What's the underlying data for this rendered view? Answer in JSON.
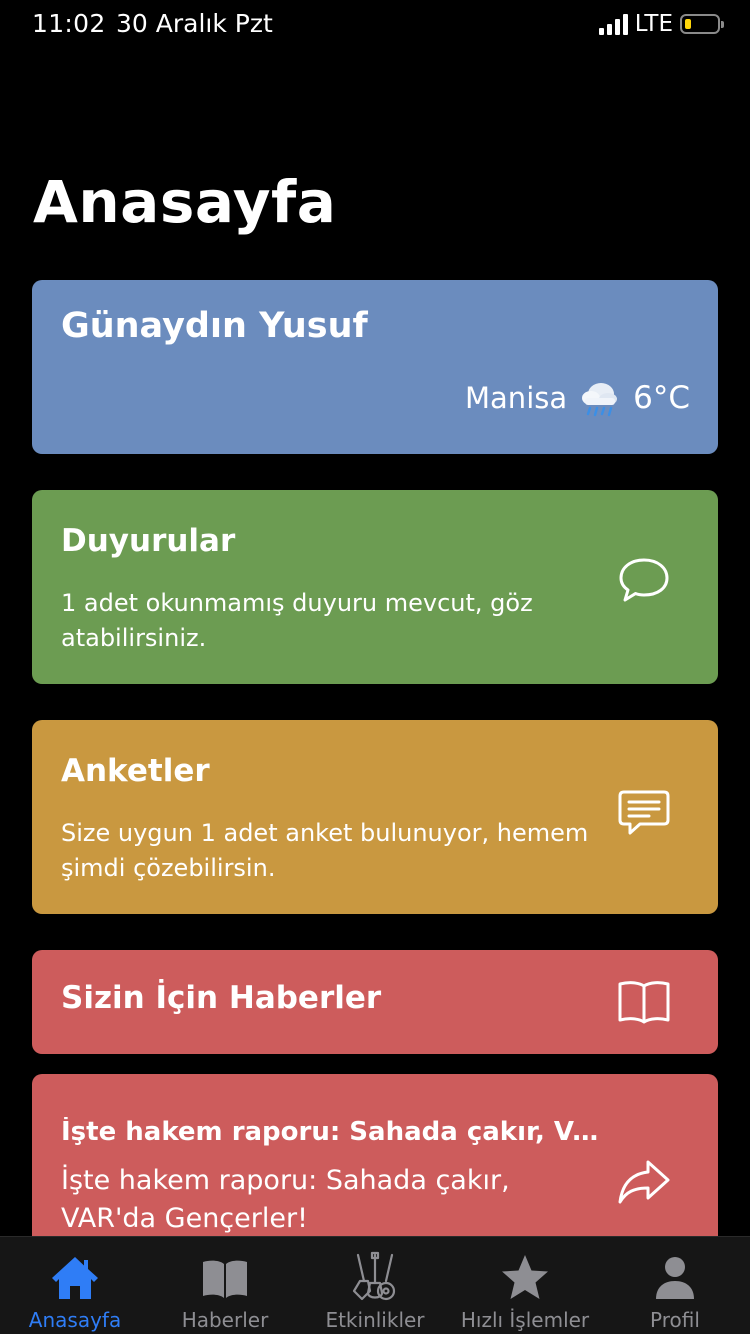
{
  "status_bar": {
    "time": "11:02",
    "date": "30 Aralık Pzt",
    "carrier": "LTE",
    "battery_level": 0.2,
    "battery_color": "#ffd60a"
  },
  "page": {
    "title": "Anasayfa"
  },
  "greeting": {
    "text": "Günaydın Yusuf",
    "city": "Manisa",
    "weather_icon": "rain-cloud-icon",
    "temperature": "6°C",
    "color": "#6b8cbe"
  },
  "announcements": {
    "title": "Duyurular",
    "description": "1 adet okunmamış duyuru mevcut, göz atabilirsiniz.",
    "icon": "chat-bubble-icon",
    "color": "#6c9c52"
  },
  "surveys": {
    "title": "Anketler",
    "description": "Size uygun 1 adet anket bulunuyor, hemem şimdi çözebilirsin.",
    "icon": "message-lines-icon",
    "color": "#c99840"
  },
  "news": {
    "title": "Sizin İçin Haberler",
    "icon": "open-book-icon",
    "color": "#cd5c5c"
  },
  "article": {
    "title": "İşte hakem raporu: Sahada çakır, VAR...",
    "description": "İşte hakem raporu: Sahada çakır, VAR'da Gençerler!",
    "icon": "share-arrow-icon",
    "color": "#cd5c5c"
  },
  "tabs": [
    {
      "label": "Anasayfa",
      "icon": "home-icon",
      "active": true
    },
    {
      "label": "Haberler",
      "icon": "book-icon",
      "active": false
    },
    {
      "label": "Etkinlikler",
      "icon": "guitars-icon",
      "active": false
    },
    {
      "label": "Hızlı İşlemler",
      "icon": "star-icon",
      "active": false
    },
    {
      "label": "Profil",
      "icon": "person-icon",
      "active": false
    }
  ],
  "colors": {
    "tab_active": "#2f7df6",
    "tab_inactive": "#8e8e93"
  }
}
